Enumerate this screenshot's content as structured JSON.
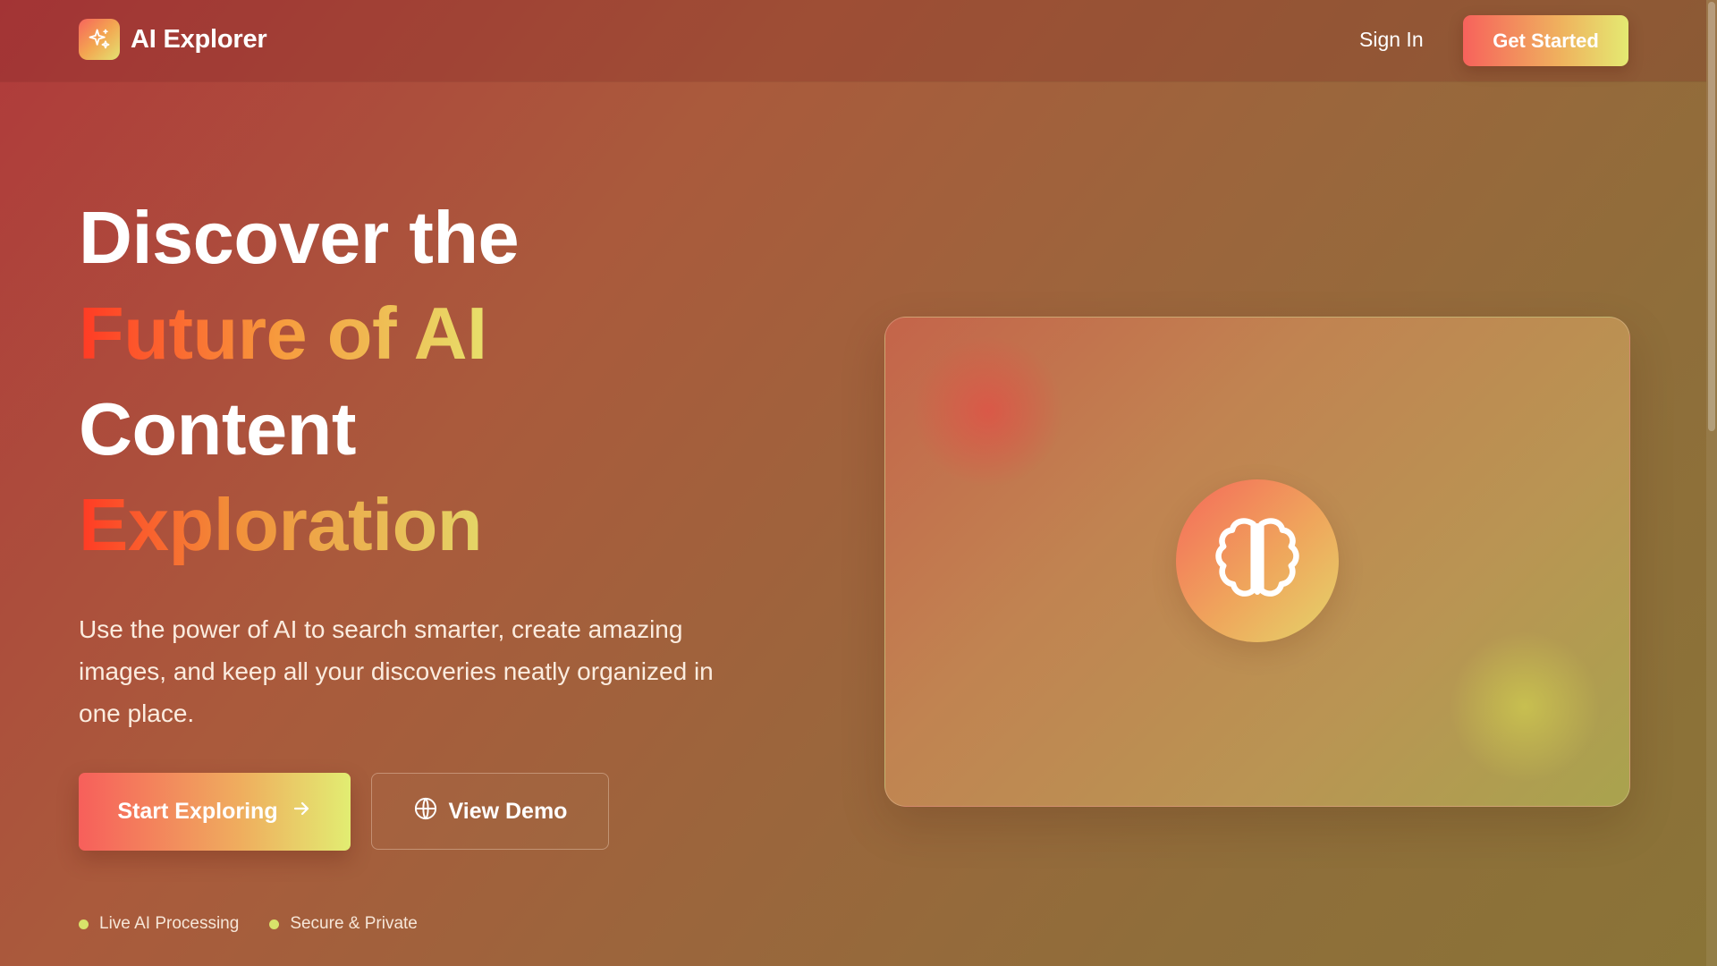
{
  "header": {
    "brand": "AI Explorer",
    "sign_in": "Sign In",
    "get_started": "Get Started"
  },
  "hero": {
    "title_lines": [
      "Discover the",
      "Future of AI",
      "Content",
      "Exploration"
    ],
    "description": "Use the power of AI to search smarter, create amazing images, and keep all your discoveries neatly organized in one place.",
    "primary_cta": "Start Exploring",
    "secondary_cta": "View Demo",
    "badges": [
      "Live AI Processing",
      "Secure & Private"
    ]
  },
  "icons": {
    "logo": "sparkles-icon",
    "primary_cta": "arrow-right-icon",
    "secondary_cta": "globe-icon",
    "card": "brain-icon"
  },
  "colors": {
    "accent_start": "#f7625c",
    "accent_mid": "#efb35e",
    "accent_end": "#e4ea72",
    "background": "#a55a3c",
    "status_dot": "#d8e36a"
  }
}
